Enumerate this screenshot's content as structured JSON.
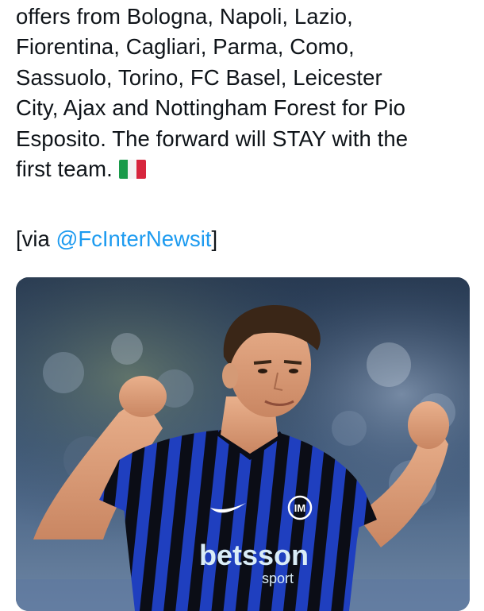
{
  "tweet": {
    "body": "offers from Bologna, Napoli, Lazio,\nFiorentina, Cagliari, Parma, Como,\nSassuolo, Torino, FC Basel, Leicester\nCity, Ajax and Nottingham Forest for Pio\nEsposito. The forward will STAY with the\nfirst team.",
    "flag_icon": "italy-flag-icon",
    "via_prefix": "[via ",
    "mention": "@FcInterNewsit",
    "via_suffix": "]"
  },
  "media": {
    "kit_sponsor": "betsson",
    "kit_sponsor_sub": "sport"
  },
  "colors": {
    "text": "#0f1419",
    "link": "#1d9bf0",
    "kit_blue": "#1f3fbf",
    "kit_black": "#0b0d16"
  }
}
